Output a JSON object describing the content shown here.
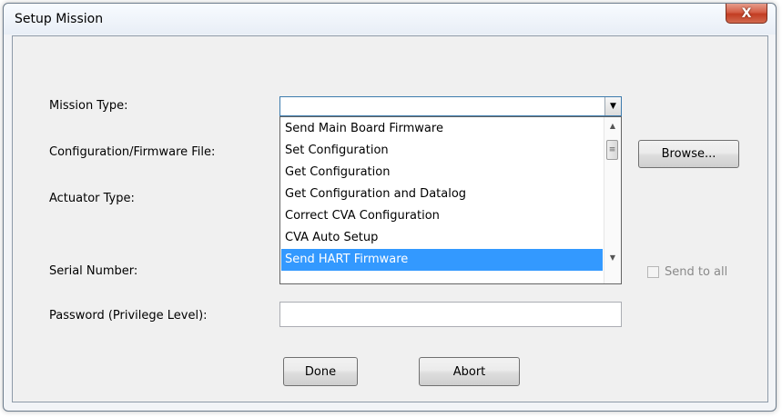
{
  "window": {
    "title": "Setup Mission",
    "close_label": "X"
  },
  "form": {
    "mission_type_label": "Mission Type:",
    "config_file_label": "Configuration/Firmware File:",
    "actuator_type_label": "Actuator Type:",
    "serial_number_label": "Serial Number:",
    "password_label": "Password (Privilege Level):",
    "mission_type_value": "",
    "password_value": ""
  },
  "dropdown": {
    "options": [
      "Send Main Board Firmware",
      "Set Configuration",
      "Get Configuration",
      "Get Configuration and  Datalog",
      "Correct CVA Configuration",
      "CVA Auto Setup",
      "Send HART Firmware"
    ],
    "selected_option": "Send HART Firmware"
  },
  "buttons": {
    "browse": "Browse...",
    "done": "Done",
    "abort": "Abort"
  },
  "checkbox": {
    "send_to_all_label": "Send to all",
    "checked": false
  },
  "icons": {
    "close": "close-icon",
    "combo_arrow": "chevron-down-icon",
    "scroll_up": "scroll-up-icon",
    "scroll_down": "scroll-down-icon"
  },
  "colors": {
    "selection": "#3399ff",
    "close_button": "#c23c22"
  }
}
